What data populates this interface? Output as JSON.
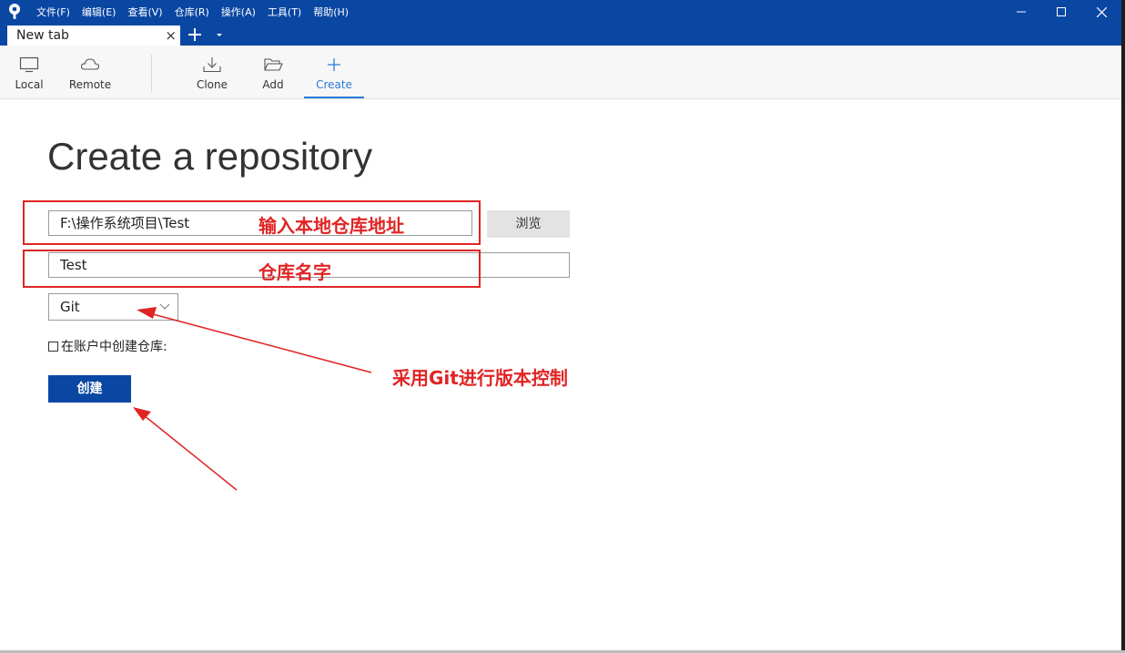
{
  "menubar": {
    "items": [
      "文件(F)",
      "编辑(E)",
      "查看(V)",
      "仓库(R)",
      "操作(A)",
      "工具(T)",
      "帮助(H)"
    ]
  },
  "window_controls": {
    "minimize": "—",
    "maximize": "☐",
    "close": "✕"
  },
  "tabs": {
    "current": "New tab",
    "close_glyph": "×"
  },
  "toolbar": {
    "local": "Local",
    "remote": "Remote",
    "clone": "Clone",
    "add": "Add",
    "create": "Create",
    "active": "create"
  },
  "main": {
    "title": "Create a repository",
    "path_value": "F:\\操作系统项目\\Test",
    "browse_label": "浏览",
    "name_value": "Test",
    "vcs_selected": "Git",
    "account_checkbox_label": "在账户中创建仓库:",
    "account_checked": false,
    "create_label": "创建"
  },
  "annotations": {
    "path_note": "输入本地仓库地址",
    "name_note": "仓库名字",
    "vcs_note": "采用Git进行版本控制",
    "color": "#e02424"
  },
  "colors": {
    "titlebar": "#0a47a3",
    "accent": "#2b7bd8",
    "create_button": "#0a47a3"
  }
}
